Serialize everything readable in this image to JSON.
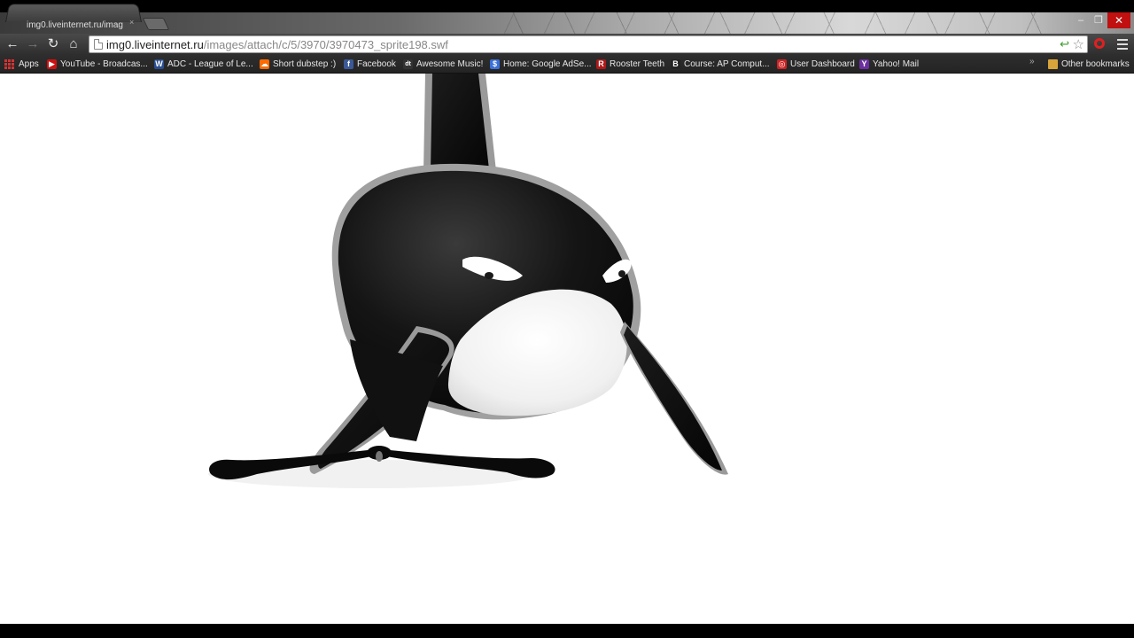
{
  "tab": {
    "title": "img0.liveinternet.ru/imag",
    "close_glyph": "×"
  },
  "window_controls": {
    "minimize": "–",
    "restore": "❐",
    "close": "✕"
  },
  "toolbar": {
    "back": "←",
    "forward": "→",
    "reload": "↻",
    "home": "⌂",
    "url_host": "img0.liveinternet.ru",
    "url_path": "/images/attach/c/5/3970/3970473_sprite198.swf",
    "star": "☆",
    "go": "↩"
  },
  "bookmarks": [
    {
      "label": "Apps",
      "icon": "apps-icon",
      "color": "#d33333"
    },
    {
      "label": "YouTube - Broadcas...",
      "icon": "youtube-icon",
      "color": "#cc1111",
      "glyph": "▶"
    },
    {
      "label": "ADC - League of Le...",
      "icon": "w-icon",
      "color": "#2a4d8f",
      "glyph": "W"
    },
    {
      "label": "Short dubstep :)",
      "icon": "soundcloud-icon",
      "color": "#ff6a00",
      "glyph": "☁"
    },
    {
      "label": "Facebook",
      "icon": "facebook-icon",
      "color": "#3b5998",
      "glyph": "f"
    },
    {
      "label": "Awesome Music!",
      "icon": "dt-icon",
      "color": "#333333",
      "glyph": "dt"
    },
    {
      "label": "Home: Google AdSe...",
      "icon": "adsense-icon",
      "color": "#3a6fd8",
      "glyph": "$"
    },
    {
      "label": "Rooster Teeth",
      "icon": "roosterteeth-icon",
      "color": "#b01818",
      "glyph": "R"
    },
    {
      "label": "Course: AP Comput...",
      "icon": "blackboard-icon",
      "color": "#222222",
      "glyph": "B"
    },
    {
      "label": "User Dashboard",
      "icon": "dashboard-icon",
      "color": "#cc2222",
      "glyph": "◎"
    },
    {
      "label": "Yahoo! Mail",
      "icon": "yahoo-icon",
      "color": "#6b2fa0",
      "glyph": "Y"
    }
  ],
  "other_bookmarks": "Other bookmarks",
  "bookmarks_more": "»"
}
